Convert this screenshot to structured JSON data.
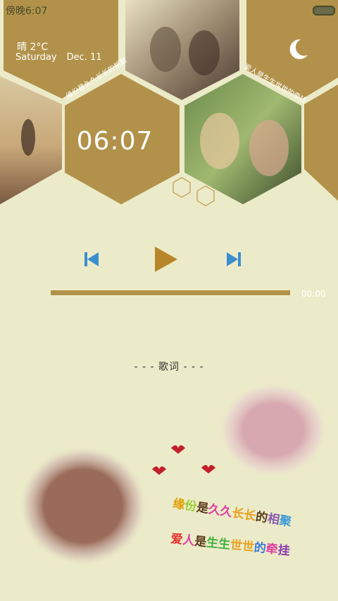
{
  "status_bar": {
    "time": "傍晚6:07"
  },
  "weather": {
    "condition": "晴",
    "temperature": "2°C"
  },
  "date": {
    "weekday": "Saturday",
    "day": "Dec. 11"
  },
  "clock": {
    "time": "06:07"
  },
  "tiles": {
    "caption_left": "缘份是久久长长的相聚",
    "caption_right": "爱人是生生世世的牵挂"
  },
  "player": {
    "progress_time": "00:00",
    "progress": 0.0
  },
  "lyrics": {
    "header": "- - - 歌词 - - -"
  },
  "poem": {
    "line1": [
      "缘",
      "份",
      "是",
      "久",
      "久",
      "长",
      "长",
      "的",
      "相",
      "聚"
    ],
    "line2": [
      "爱",
      "人",
      "是",
      "生",
      "生",
      "世",
      "世",
      "的",
      "牵",
      "挂"
    ],
    "line1_colors": [
      "#e0a000",
      "#9acd32",
      "#5a3a1a",
      "#e040a0",
      "#e040a0",
      "#e8a020",
      "#e8a020",
      "#5a3a1a",
      "#8a5ab0",
      "#3a9ad8"
    ],
    "line2_colors": [
      "#e8302a",
      "#e040a0",
      "#5a3a1a",
      "#40b040",
      "#40b040",
      "#e8a020",
      "#e8a020",
      "#3a7ad8",
      "#e040a0",
      "#8a3ab0"
    ]
  },
  "colors": {
    "background": "#ecebc9",
    "hex": "#b2924a",
    "accent_blue": "#3a8ed0",
    "play": "#b8862a"
  }
}
